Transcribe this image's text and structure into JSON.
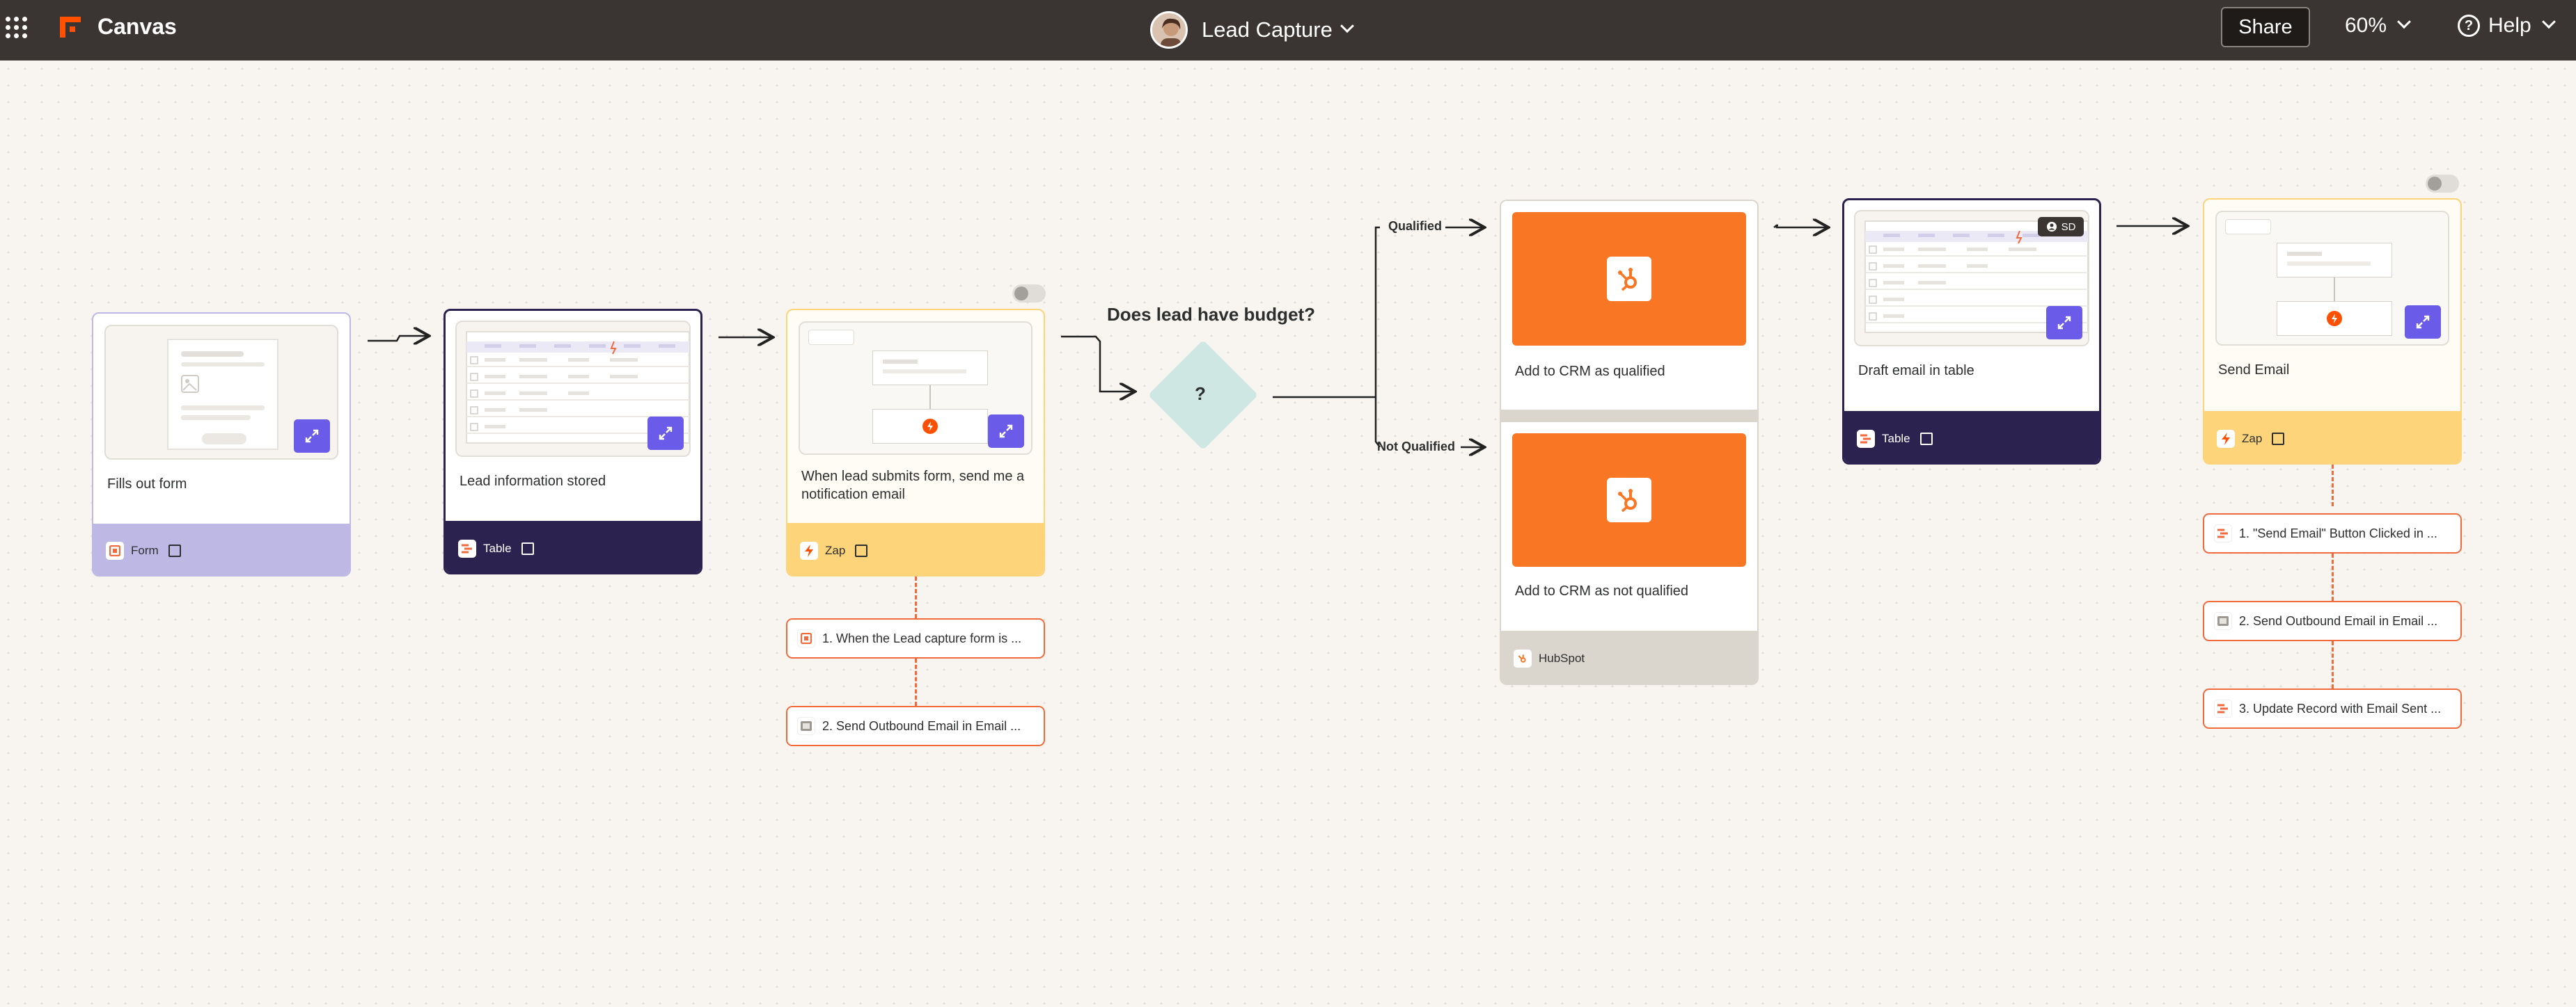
{
  "topbar": {
    "app_title": "Canvas",
    "zap_name": "Lead Capture",
    "share_label": "Share",
    "zoom_label": "60%",
    "help_label": "Help"
  },
  "colors": {
    "topbar_bg": "#3a3532",
    "accent_orange": "#f06a3c",
    "expand_purple": "#6a5be8",
    "form_foot": "#bdb8e4",
    "table_foot": "#2b2250",
    "zap_foot": "#fdd47a",
    "hubspot_orange": "#f97724",
    "hubspot_foot": "#dad6ce",
    "decision_diamond": "#cfe7e2"
  },
  "nodes": {
    "form": {
      "title": "Fills out form",
      "app_label": "Form",
      "icon": "form-icon"
    },
    "table1": {
      "title": "Lead information stored",
      "app_label": "Table",
      "icon": "table-icon"
    },
    "zap1": {
      "title_line1": "When lead submits form, send me a",
      "title_line2": "notification email",
      "app_label": "Zap",
      "icon": "zap-icon"
    },
    "decision": {
      "question": "Does lead have budget?",
      "symbol": "?",
      "branch_yes": "Qualified",
      "branch_no": "Not Qualified"
    },
    "crm": {
      "title_qualified": "Add to CRM as qualified",
      "title_not_qualified": "Add to CRM as not qualified",
      "app_label": "HubSpot",
      "icon": "hubspot-icon"
    },
    "table2": {
      "title": "Draft email in table",
      "app_label": "Table",
      "badge": "SD",
      "icon": "table-icon"
    },
    "zap2": {
      "title": "Send Email",
      "app_label": "Zap",
      "icon": "zap-icon"
    }
  },
  "zap1_steps": [
    {
      "label": "1. When the Lead capture form is ...",
      "icon": "form-icon"
    },
    {
      "label": "2. Send Outbound Email in Email ...",
      "icon": "email-icon"
    }
  ],
  "zap2_steps": [
    {
      "label": "1. \"Send Email\" Button Clicked in ...",
      "icon": "table-icon"
    },
    {
      "label": "2. Send Outbound Email in Email ...",
      "icon": "email-icon"
    },
    {
      "label": "3. Update Record with Email Sent ...",
      "icon": "table-icon"
    }
  ]
}
